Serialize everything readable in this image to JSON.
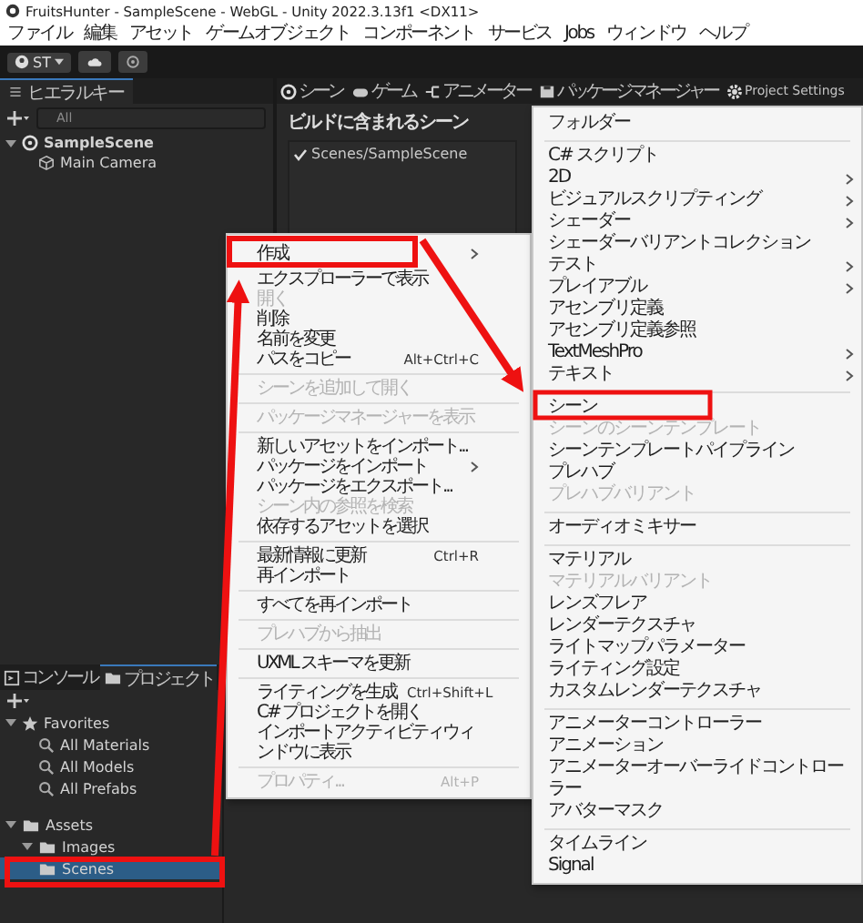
{
  "title_bar": {
    "title": "FruitsHunter - SampleScene - WebGL - Unity 2022.3.13f1 <DX11>"
  },
  "menu_bar": [
    "ファイル",
    "編集",
    "アセット",
    "ゲームオブジェクト",
    "コンポーネント",
    "サービス",
    "Jobs",
    "ウィンドウ",
    "ヘルプ"
  ],
  "toolbar": {
    "account": "ST"
  },
  "hierarchy": {
    "tab": "ヒエラルキー",
    "search": {
      "placeholder": "All"
    },
    "tree": [
      {
        "label": "SampleScene",
        "kind": "scene",
        "expanded": true,
        "children": [
          {
            "label": "Main Camera",
            "kind": "camera"
          }
        ]
      }
    ]
  },
  "scene_panel": {
    "tabs": [
      {
        "label": "シーン",
        "kind": "scene"
      },
      {
        "label": "ゲーム",
        "kind": "game"
      },
      {
        "label": "アニメーター",
        "kind": "animator"
      },
      {
        "label": "パッケージマネージャー",
        "kind": "package"
      },
      {
        "label": "Project Settings",
        "kind": "settings"
      }
    ],
    "build_settings": {
      "heading": "ビルドに含まれるシーン",
      "scenes": [
        {
          "path": "Scenes/SampleScene",
          "checked": true
        }
      ]
    }
  },
  "project_panel": {
    "tabs": [
      {
        "label": "コンソール",
        "kind": "console",
        "selected": false
      },
      {
        "label": "プロジェクト",
        "kind": "folder",
        "selected": true
      }
    ],
    "tree": [
      {
        "label": "Favorites",
        "kind": "favorites",
        "expanded": true,
        "selected": false,
        "children": [
          {
            "label": "All Materials",
            "kind": "search",
            "selected": false
          },
          {
            "label": "All Models",
            "kind": "search",
            "selected": false
          },
          {
            "label": "All Prefabs",
            "kind": "search",
            "selected": false
          }
        ]
      },
      {
        "label": "Assets",
        "kind": "folder",
        "expanded": true,
        "selected": false,
        "children": [
          {
            "label": "Images",
            "kind": "folder",
            "expanded": true,
            "selected": false
          },
          {
            "label": "Scenes",
            "kind": "folder",
            "selected": true
          }
        ]
      }
    ]
  },
  "context_menu": {
    "items": [
      {
        "kind": "item",
        "label": "作成",
        "submenu": true,
        "disabled": false
      },
      {
        "kind": "item",
        "label": "エクスプローラーで表示",
        "submenu": false,
        "disabled": false
      },
      {
        "kind": "item",
        "label": "開く",
        "submenu": false,
        "disabled": true
      },
      {
        "kind": "item",
        "label": "削除",
        "submenu": false,
        "disabled": false
      },
      {
        "kind": "item",
        "label": "名前を変更",
        "submenu": false,
        "disabled": false
      },
      {
        "kind": "item",
        "label": "パスをコピー",
        "shortcut": "Alt+Ctrl+C",
        "submenu": false,
        "disabled": false
      },
      {
        "kind": "separator"
      },
      {
        "kind": "item",
        "label": "シーンを追加して開く",
        "submenu": false,
        "disabled": true
      },
      {
        "kind": "separator"
      },
      {
        "kind": "item",
        "label": "パッケージマネージャーを表示",
        "submenu": false,
        "disabled": true
      },
      {
        "kind": "separator"
      },
      {
        "kind": "item",
        "label": "新しいアセットをインポート...",
        "submenu": false,
        "disabled": false
      },
      {
        "kind": "item",
        "label": "パッケージをインポート",
        "submenu": true,
        "disabled": false
      },
      {
        "kind": "item",
        "label": "パッケージをエクスポート...",
        "submenu": false,
        "disabled": false
      },
      {
        "kind": "item",
        "label": "シーン内の参照を検索",
        "submenu": false,
        "disabled": true
      },
      {
        "kind": "item",
        "label": "依存するアセットを選択",
        "submenu": false,
        "disabled": false
      },
      {
        "kind": "separator"
      },
      {
        "kind": "item",
        "label": "最新情報に更新",
        "shortcut": "Ctrl+R",
        "submenu": false,
        "disabled": false
      },
      {
        "kind": "item",
        "label": "再インポート",
        "submenu": false,
        "disabled": false
      },
      {
        "kind": "separator"
      },
      {
        "kind": "item",
        "label": "すべてを再インポート",
        "submenu": false,
        "disabled": false
      },
      {
        "kind": "separator"
      },
      {
        "kind": "item",
        "label": "プレハブから抽出",
        "submenu": false,
        "disabled": true
      },
      {
        "kind": "separator"
      },
      {
        "kind": "item",
        "label": "UXML スキーマを更新",
        "submenu": false,
        "disabled": false
      },
      {
        "kind": "separator"
      },
      {
        "kind": "item",
        "label": "ライティングを生成",
        "shortcut": "Ctrl+Shift+L",
        "submenu": false,
        "disabled": false
      },
      {
        "kind": "item",
        "label": "C# プロジェクトを開く",
        "submenu": false,
        "disabled": false
      },
      {
        "kind": "item",
        "label": "インポートアクティビティウィンドウに表示",
        "submenu": false,
        "disabled": false
      },
      {
        "kind": "separator"
      },
      {
        "kind": "item",
        "label": "プロパティ...",
        "shortcut": "Alt+P",
        "submenu": false,
        "disabled": true
      }
    ]
  },
  "create_submenu": {
    "items": [
      {
        "kind": "item",
        "label": "フォルダー",
        "submenu": false,
        "disabled": false
      },
      {
        "kind": "separator"
      },
      {
        "kind": "item",
        "label": "C# スクリプト",
        "submenu": false,
        "disabled": false
      },
      {
        "kind": "item",
        "label": "2D",
        "submenu": true,
        "disabled": false
      },
      {
        "kind": "item",
        "label": "ビジュアルスクリプティング",
        "submenu": true,
        "disabled": false
      },
      {
        "kind": "item",
        "label": "シェーダー",
        "submenu": true,
        "disabled": false
      },
      {
        "kind": "item",
        "label": "シェーダーバリアントコレクション",
        "submenu": false,
        "disabled": false
      },
      {
        "kind": "item",
        "label": "テスト",
        "submenu": true,
        "disabled": false
      },
      {
        "kind": "item",
        "label": "プレイアブル",
        "submenu": true,
        "disabled": false
      },
      {
        "kind": "item",
        "label": "アセンブリ定義",
        "submenu": false,
        "disabled": false
      },
      {
        "kind": "item",
        "label": "アセンブリ定義参照",
        "submenu": false,
        "disabled": false
      },
      {
        "kind": "item",
        "label": "TextMeshPro",
        "submenu": true,
        "disabled": false
      },
      {
        "kind": "item",
        "label": "テキスト",
        "submenu": true,
        "disabled": false
      },
      {
        "kind": "separator"
      },
      {
        "kind": "item",
        "label": "シーン",
        "submenu": false,
        "disabled": false
      },
      {
        "kind": "item",
        "label": "シーンのシーンテンプレート",
        "submenu": false,
        "disabled": true
      },
      {
        "kind": "item",
        "label": "シーンテンプレートパイプライン",
        "submenu": false,
        "disabled": false
      },
      {
        "kind": "item",
        "label": "プレハブ",
        "submenu": false,
        "disabled": false
      },
      {
        "kind": "item",
        "label": "プレハブバリアント",
        "submenu": false,
        "disabled": true
      },
      {
        "kind": "separator"
      },
      {
        "kind": "item",
        "label": "オーディオミキサー",
        "submenu": false,
        "disabled": false
      },
      {
        "kind": "separator"
      },
      {
        "kind": "item",
        "label": "マテリアル",
        "submenu": false,
        "disabled": false
      },
      {
        "kind": "item",
        "label": "マテリアルバリアント",
        "submenu": false,
        "disabled": true
      },
      {
        "kind": "item",
        "label": "レンズフレア",
        "submenu": false,
        "disabled": false
      },
      {
        "kind": "item",
        "label": "レンダーテクスチャ",
        "submenu": false,
        "disabled": false
      },
      {
        "kind": "item",
        "label": "ライトマップパラメーター",
        "submenu": false,
        "disabled": false
      },
      {
        "kind": "item",
        "label": "ライティング設定",
        "submenu": false,
        "disabled": false
      },
      {
        "kind": "item",
        "label": "カスタムレンダーテクスチャ",
        "submenu": false,
        "disabled": false
      },
      {
        "kind": "separator"
      },
      {
        "kind": "item",
        "label": "アニメーターコントローラー",
        "submenu": false,
        "disabled": false
      },
      {
        "kind": "item",
        "label": "アニメーション",
        "submenu": false,
        "disabled": false
      },
      {
        "kind": "item",
        "label": "アニメーターオーバーライドコントローラー",
        "submenu": false,
        "disabled": false
      },
      {
        "kind": "item",
        "label": "アバターマスク",
        "submenu": false,
        "disabled": false
      },
      {
        "kind": "separator"
      },
      {
        "kind": "item",
        "label": "タイムライン",
        "submenu": false,
        "disabled": false
      },
      {
        "kind": "item",
        "label": "Signal",
        "submenu": false,
        "disabled": false
      }
    ]
  }
}
